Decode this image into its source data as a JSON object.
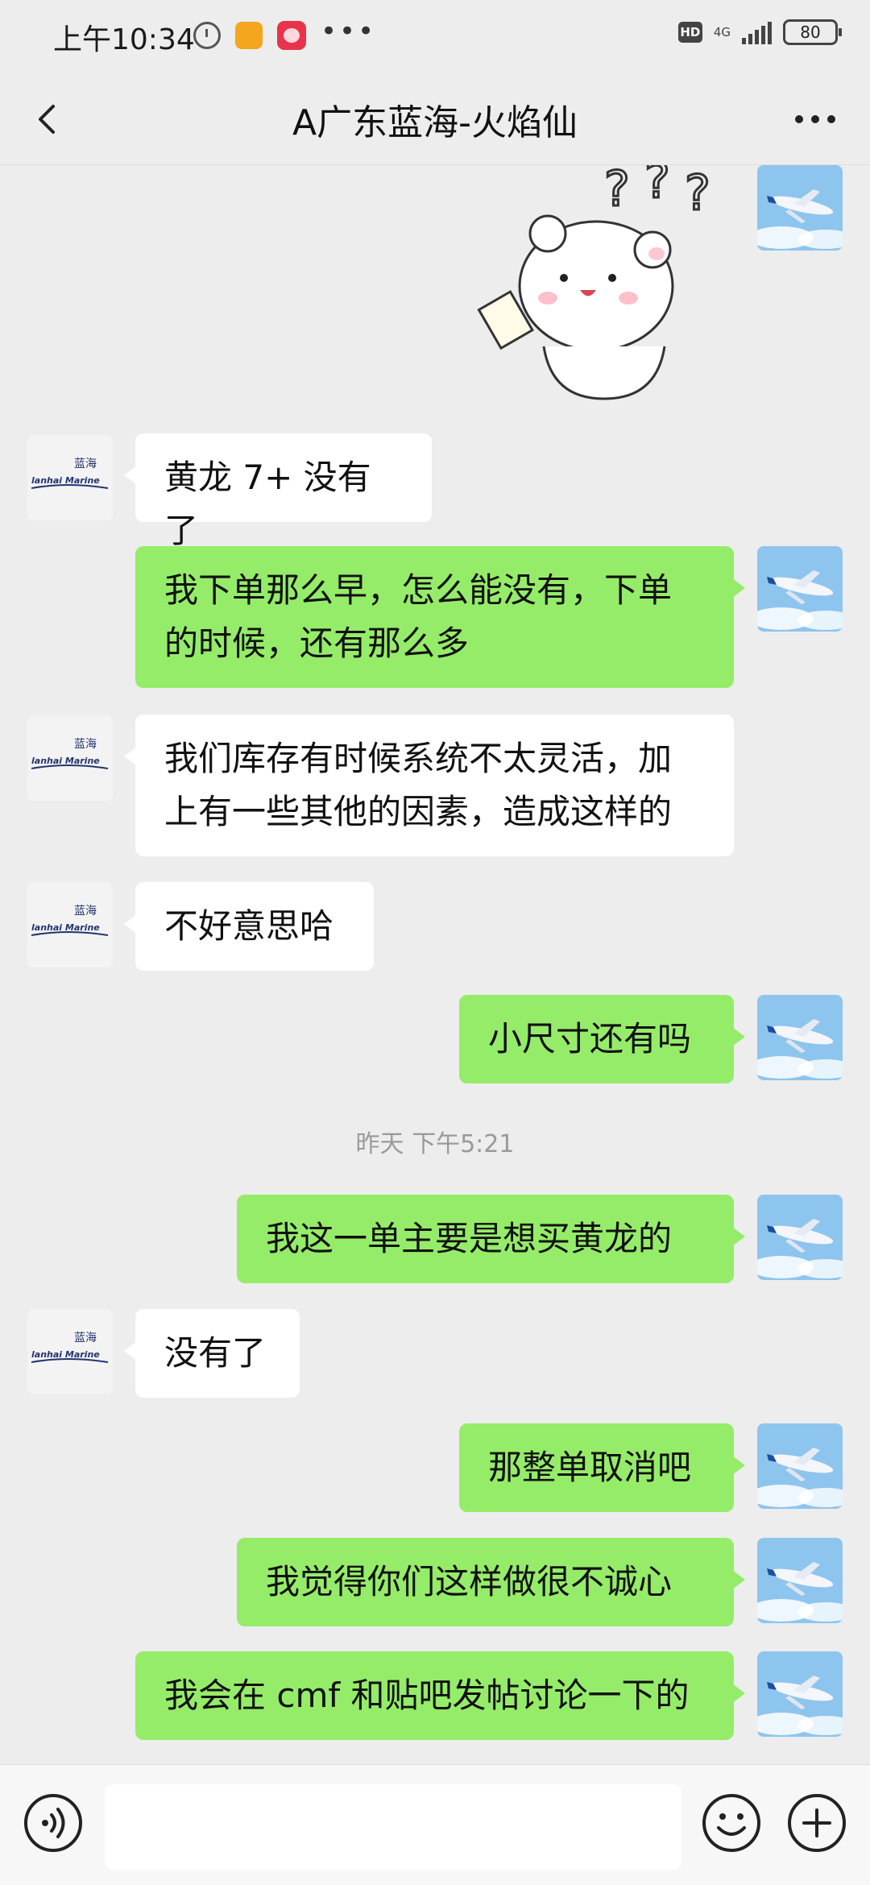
{
  "status_bar": {
    "time": "上午10:34",
    "hd": "HD",
    "network": "4G",
    "battery": "80"
  },
  "nav": {
    "title": "A广东蓝海-火焰仙"
  },
  "avatars": {
    "other_logo_cn": "蓝海",
    "other_logo_en": "lanhai Marine"
  },
  "messages": [
    {
      "side": "self",
      "type": "sticker"
    },
    {
      "side": "other",
      "text": "黄龙 7+ 没有了"
    },
    {
      "side": "self",
      "text": "我下单那么早，怎么能没有，下单的时候，还有那么多"
    },
    {
      "side": "other",
      "text": "我们库存有时候系统不太灵活，加上有一些其他的因素，造成这样的"
    },
    {
      "side": "other",
      "text": "不好意思哈"
    },
    {
      "side": "self",
      "text": "小尺寸还有吗"
    },
    {
      "side": "self",
      "text": "我这一单主要是想买黄龙的"
    },
    {
      "side": "other",
      "text": "没有了"
    },
    {
      "side": "self",
      "text": "那整单取消吧"
    },
    {
      "side": "self",
      "text": "我觉得你们这样做很不诚心"
    },
    {
      "side": "self",
      "text": "我会在 cmf 和贴吧发帖讨论一下的"
    }
  ],
  "divider": {
    "time": "昨天 下午5:21"
  },
  "input_bar": {
    "placeholder": ""
  },
  "colors": {
    "self_bubble": "#95ec69",
    "other_bubble": "#ffffff",
    "background": "#ededed"
  }
}
